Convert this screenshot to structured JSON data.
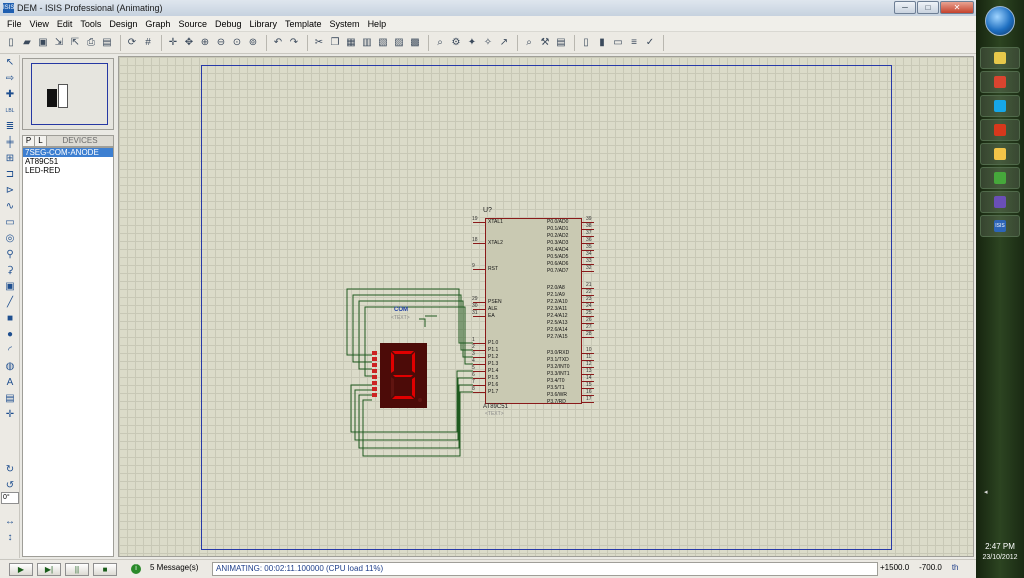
{
  "window": {
    "icon_text": "ISIS",
    "title": "DEM - ISIS Professional (Animating)",
    "minimize": "─",
    "maximize": "□",
    "close": "✕"
  },
  "menubar": [
    "File",
    "View",
    "Edit",
    "Tools",
    "Design",
    "Graph",
    "Source",
    "Debug",
    "Library",
    "Template",
    "System",
    "Help"
  ],
  "toolbar_icons": [
    "new-file-icon",
    "open-folder-icon",
    "save-icon",
    "import-icon",
    "export-icon",
    "print-icon",
    "printer-setup-icon",
    "refresh-icon",
    "grid-icon",
    "origin-icon",
    "pan-icon",
    "zoom-in-icon",
    "zoom-out-icon",
    "zoom-all-icon",
    "zoom-area-icon",
    "undo-icon",
    "redo-icon",
    "cut-icon",
    "copy-icon",
    "paste-icon",
    "block-copy-icon",
    "block-move-icon",
    "block-rotate-icon",
    "block-delete-icon",
    "pick-device-icon",
    "make-device-icon",
    "packaging-icon",
    "decompose-icon",
    "wire-autoroute-icon",
    "search-icon",
    "property-assign-icon",
    "design-explorer-icon",
    "new-sheet-icon",
    "remove-sheet-icon",
    "goto-sheet-icon",
    "bom-icon",
    "electrical-check-icon"
  ],
  "left_tools": [
    "selection-mode-icon",
    "component-mode-icon",
    "junction-icon",
    "wire-label-icon",
    "text-script-icon",
    "bus-icon",
    "subcircuit-icon",
    "terminals-icon",
    "device-pins-icon",
    "graph-icon",
    "tape-recorder-icon",
    "generator-icon",
    "voltage-probe-icon",
    "current-probe-icon",
    "virtual-instrument-icon",
    "line-icon",
    "box-icon",
    "circle-icon",
    "arc-icon",
    "path-icon",
    "text-icon",
    "symbol-icon",
    "marker-icon"
  ],
  "rotation": {
    "rotate_cw": "↻",
    "rotate_ccw": "↺",
    "angle": "0°",
    "mirror_h": "↔",
    "mirror_v": "↕"
  },
  "devices": {
    "tab_p": "P",
    "tab_l": "L",
    "header": "DEVICES",
    "items": [
      "7SEG-COM-ANODE",
      "AT89C51",
      "LED-RED"
    ],
    "selected_index": 0
  },
  "schematic": {
    "chip_ref": "U?",
    "chip_name": "AT89C51",
    "chip_text": "<TEXT>",
    "left_pins": [
      {
        "num": "19",
        "label": "XTAL1"
      },
      {
        "num": "18",
        "label": "XTAL2"
      },
      {
        "num": "9",
        "label": "RST"
      },
      {
        "num": "29",
        "label": "PSEN"
      },
      {
        "num": "30",
        "label": "ALE"
      },
      {
        "num": "31",
        "label": "EA"
      },
      {
        "num": "1",
        "label": "P1.0"
      },
      {
        "num": "2",
        "label": "P1.1"
      },
      {
        "num": "3",
        "label": "P1.2"
      },
      {
        "num": "4",
        "label": "P1.3"
      },
      {
        "num": "5",
        "label": "P1.4"
      },
      {
        "num": "6",
        "label": "P1.5"
      },
      {
        "num": "7",
        "label": "P1.6"
      },
      {
        "num": "8",
        "label": "P1.7"
      }
    ],
    "right_pins": [
      {
        "num": "39",
        "label": "P0.0/AD0"
      },
      {
        "num": "38",
        "label": "P0.1/AD1"
      },
      {
        "num": "37",
        "label": "P0.2/AD2"
      },
      {
        "num": "36",
        "label": "P0.3/AD3"
      },
      {
        "num": "35",
        "label": "P0.4/AD4"
      },
      {
        "num": "34",
        "label": "P0.5/AD5"
      },
      {
        "num": "33",
        "label": "P0.6/AD6"
      },
      {
        "num": "32",
        "label": "P0.7/AD7"
      },
      {
        "num": "21",
        "label": "P2.0/A8"
      },
      {
        "num": "22",
        "label": "P2.1/A9"
      },
      {
        "num": "23",
        "label": "P2.2/A10"
      },
      {
        "num": "24",
        "label": "P2.3/A11"
      },
      {
        "num": "25",
        "label": "P2.4/A12"
      },
      {
        "num": "26",
        "label": "P2.5/A13"
      },
      {
        "num": "27",
        "label": "P2.6/A14"
      },
      {
        "num": "28",
        "label": "P2.7/A15"
      },
      {
        "num": "10",
        "label": "P3.0/RXD"
      },
      {
        "num": "11",
        "label": "P3.1/TXD"
      },
      {
        "num": "12",
        "label": "P3.2/INT0"
      },
      {
        "num": "13",
        "label": "P3.3/INT1"
      },
      {
        "num": "14",
        "label": "P3.4/T0"
      },
      {
        "num": "15",
        "label": "P3.5/T1"
      },
      {
        "num": "16",
        "label": "P3.6/WR"
      },
      {
        "num": "17",
        "label": "P3.7/RD"
      }
    ],
    "display_digit": "9",
    "display_color": "#e00000",
    "com_label": "COM",
    "com_text": "<TEXT>",
    "wire_color": "#1f5a1f"
  },
  "status": {
    "play": "▶",
    "step": "▶|",
    "pause": "||",
    "stop": "■",
    "messages": "5 Message(s)",
    "message_icon": "i",
    "animation": "ANIMATING: 00:02:11.100000 (CPU load 11%)",
    "x": "+1500.0",
    "y": "-700.0",
    "units": "th"
  },
  "taskbar": {
    "buttons": [
      "paint-icon",
      "chrome-icon",
      "skype-icon",
      "kaspersky-icon",
      "explorer-icon",
      "back-arrow-icon",
      "visual-studio-icon",
      "isis-icon"
    ],
    "isis_label": "ISIS",
    "tray_arrow": "◂",
    "time": "2:47 PM",
    "date": "23/10/2012"
  }
}
